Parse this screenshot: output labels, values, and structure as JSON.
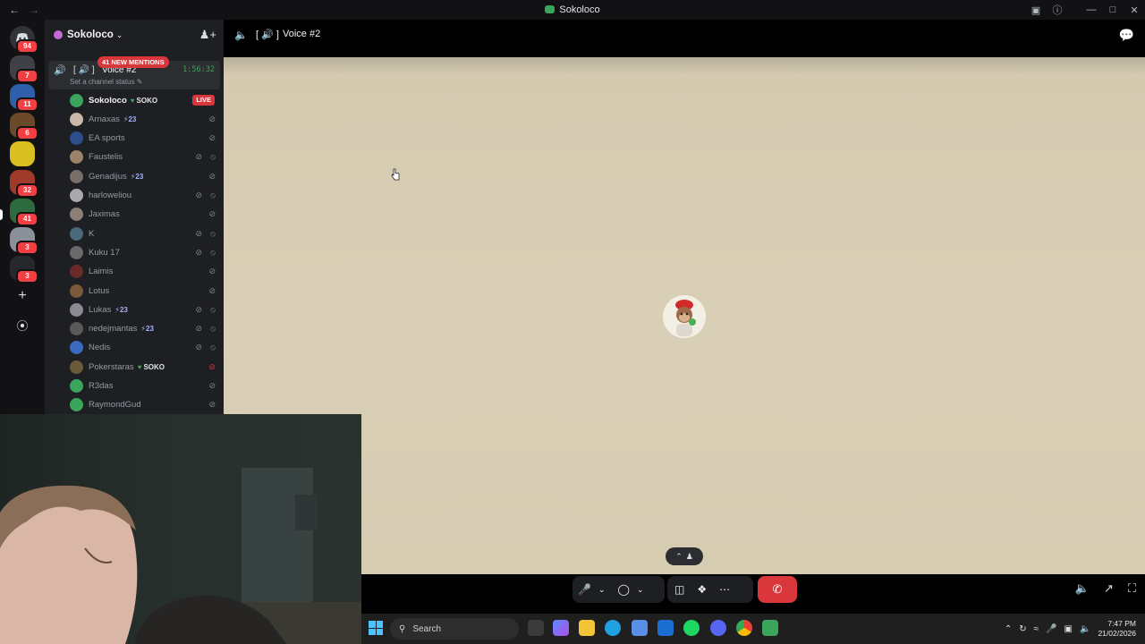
{
  "window": {
    "title": "Sokoloco"
  },
  "rail": {
    "home_badge": "94",
    "servers": [
      {
        "badge": "7",
        "color": "#3f4147"
      },
      {
        "badge": "11",
        "color": "#2f5fa8"
      },
      {
        "badge": "6",
        "color": "#6b4a2b"
      },
      {
        "badge": "",
        "color": "#d8c020"
      },
      {
        "badge": "32",
        "color": "#a03a2a"
      },
      {
        "badge": "41",
        "color": "#2d6b3e"
      },
      {
        "badge": "3",
        "color": "#8a8f98"
      },
      {
        "badge": "3",
        "color": "#26282c"
      }
    ]
  },
  "sidebar": {
    "server_name": "Sokoloco",
    "voice_channel": {
      "name": "Voice #2",
      "timer": "1:56:32",
      "status": "Set a channel status",
      "new_mentions": "41 NEW MENTIONS"
    },
    "members": [
      {
        "name": "Sokoloco",
        "tag": "SOKO",
        "tag_type": "heart",
        "live": "LIVE",
        "avatar": "#3ba55c",
        "icons": [],
        "bright": true
      },
      {
        "name": "Arnaxas",
        "tag": "23",
        "tag_type": "bolt",
        "avatar": "#c9b9a8",
        "icons": [
          "muted"
        ]
      },
      {
        "name": "EA sports",
        "tag": "",
        "tag_type": "",
        "avatar": "#2c4e8a",
        "icons": [
          "muted"
        ]
      },
      {
        "name": "Faustelis",
        "tag": "",
        "tag_type": "",
        "avatar": "#9b8268",
        "icons": [
          "muted",
          "deafened"
        ]
      },
      {
        "name": "Genadijus",
        "tag": "23",
        "tag_type": "bolt",
        "avatar": "#7a6f68",
        "icons": [
          "muted"
        ]
      },
      {
        "name": "harloweliou",
        "tag": "",
        "tag_type": "",
        "avatar": "#a9a9b0",
        "icons": [
          "muted",
          "deafened"
        ]
      },
      {
        "name": "Jaximas",
        "tag": "",
        "tag_type": "",
        "avatar": "#8b7f78",
        "icons": [
          "muted"
        ]
      },
      {
        "name": "K",
        "tag": "",
        "tag_type": "",
        "avatar": "#4a6a7a",
        "icons": [
          "muted",
          "deafened"
        ]
      },
      {
        "name": "Kuku 17",
        "tag": "",
        "tag_type": "",
        "avatar": "#6a6a6a",
        "icons": [
          "muted",
          "deafened"
        ]
      },
      {
        "name": "Laimis",
        "tag": "",
        "tag_type": "",
        "avatar": "#6a2a2a",
        "icons": [
          "muted"
        ]
      },
      {
        "name": "Lotus",
        "tag": "",
        "tag_type": "",
        "avatar": "#7a5a3a",
        "icons": [
          "muted"
        ]
      },
      {
        "name": "Lukas",
        "tag": "23",
        "tag_type": "bolt",
        "avatar": "#8a8a95",
        "icons": [
          "muted",
          "deafened"
        ]
      },
      {
        "name": "nedejmantas",
        "tag": "23",
        "tag_type": "bolt",
        "avatar": "#5a5a5a",
        "icons": [
          "muted",
          "deafened"
        ]
      },
      {
        "name": "Nedis",
        "tag": "",
        "tag_type": "",
        "avatar": "#3a6ac0",
        "icons": [
          "muted",
          "deafened"
        ]
      },
      {
        "name": "Pokerstaras",
        "tag": "SOKO",
        "tag_type": "heart",
        "avatar": "#6a5a3a",
        "icons": [
          "speaking-muted"
        ]
      },
      {
        "name": "R3das",
        "tag": "",
        "tag_type": "",
        "avatar": "#3ba55c",
        "icons": [
          "muted"
        ]
      },
      {
        "name": "RaymondGud",
        "tag": "",
        "tag_type": "",
        "avatar": "#3ba55c",
        "icons": [
          "muted"
        ]
      }
    ]
  },
  "main": {
    "channel_title": "Voice #2"
  },
  "taskbar": {
    "search_label": "Search",
    "time": "7:47 PM",
    "date": "21/02/2026"
  },
  "colors": {
    "accent_green": "#3ba55c",
    "danger_red": "#da373c",
    "stage_background": "#d9cfb6"
  }
}
